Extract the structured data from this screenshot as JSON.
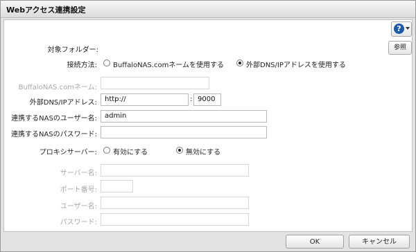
{
  "dialog": {
    "title": "Webアクセス連携設定",
    "help_symbol": "?",
    "browse_label": "参照",
    "folder_label": "対象フォルダー:",
    "method": {
      "label": "接続方法:",
      "options": [
        "BuffaloNAS.comネームを使用する",
        "外部DNS/IPアドレスを使用する"
      ],
      "selected": "外部DNS/IPアドレスを使用する"
    },
    "buffalo_name": {
      "label": "BuffaloNAS.comネーム:",
      "value": ""
    },
    "external": {
      "label": "外部DNS/IPアドレス:",
      "value": "http://",
      "port_separator": ":",
      "port": "9000"
    },
    "nas_user": {
      "label": "連携するNASのユーザー名:",
      "value": "admin"
    },
    "nas_password": {
      "label": "連携するNASのパスワード:",
      "value": ""
    },
    "proxy": {
      "label": "プロキシサーバー:",
      "options": [
        "有効にする",
        "無効にする"
      ],
      "selected": "無効にする"
    },
    "server_name": {
      "label": "サーバー名:",
      "value": ""
    },
    "port_number": {
      "label": "ポート番号:",
      "value": ""
    },
    "proxy_user": {
      "label": "ユーザー名:",
      "value": ""
    },
    "proxy_password": {
      "label": "パスワード:",
      "value": ""
    },
    "ok_label": "OK",
    "cancel_label": "キャンセル"
  }
}
